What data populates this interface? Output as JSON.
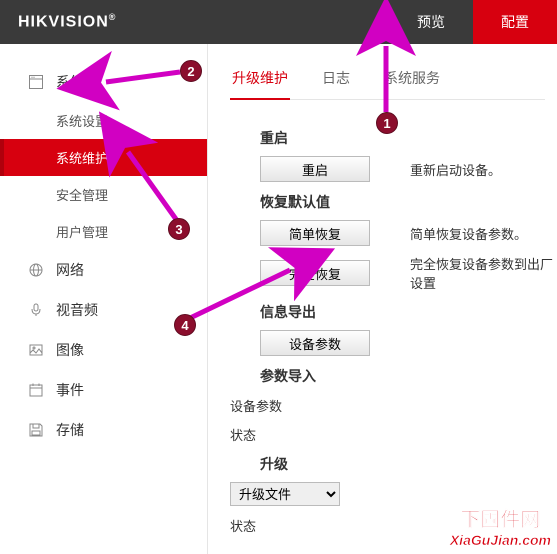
{
  "header": {
    "logo_html": "HIKVISION",
    "logo_reg": "®"
  },
  "topnav": {
    "preview": "预览",
    "config": "配置"
  },
  "sidebar": {
    "system": "系统",
    "system_settings": "系统设置",
    "system_maint": "系统维护",
    "security": "安全管理",
    "users": "用户管理",
    "network": "网络",
    "va": "视音频",
    "image": "图像",
    "event": "事件",
    "storage": "存储"
  },
  "tabs": {
    "upgrade": "升级维护",
    "log": "日志",
    "service": "系统服务"
  },
  "content": {
    "reboot_title": "重启",
    "reboot_btn": "重启",
    "reboot_desc": "重新启动设备。",
    "restore_title": "恢复默认值",
    "simple_btn": "简单恢复",
    "simple_desc": "简单恢复设备参数。",
    "full_btn": "完全恢复",
    "full_desc": "完全恢复设备参数到出厂设置",
    "export_title": "信息导出",
    "export_btn": "设备参数",
    "import_title": "参数导入",
    "import_label": "设备参数",
    "status_label": "状态",
    "upgrade_title": "升级",
    "upgrade_select": "升级文件",
    "status_label2": "状态"
  },
  "annotations": {
    "b1": "1",
    "b2": "2",
    "b3": "3",
    "b4": "4"
  },
  "watermark": {
    "top": "下固件网",
    "bottom": "XiaGuJian.com"
  }
}
